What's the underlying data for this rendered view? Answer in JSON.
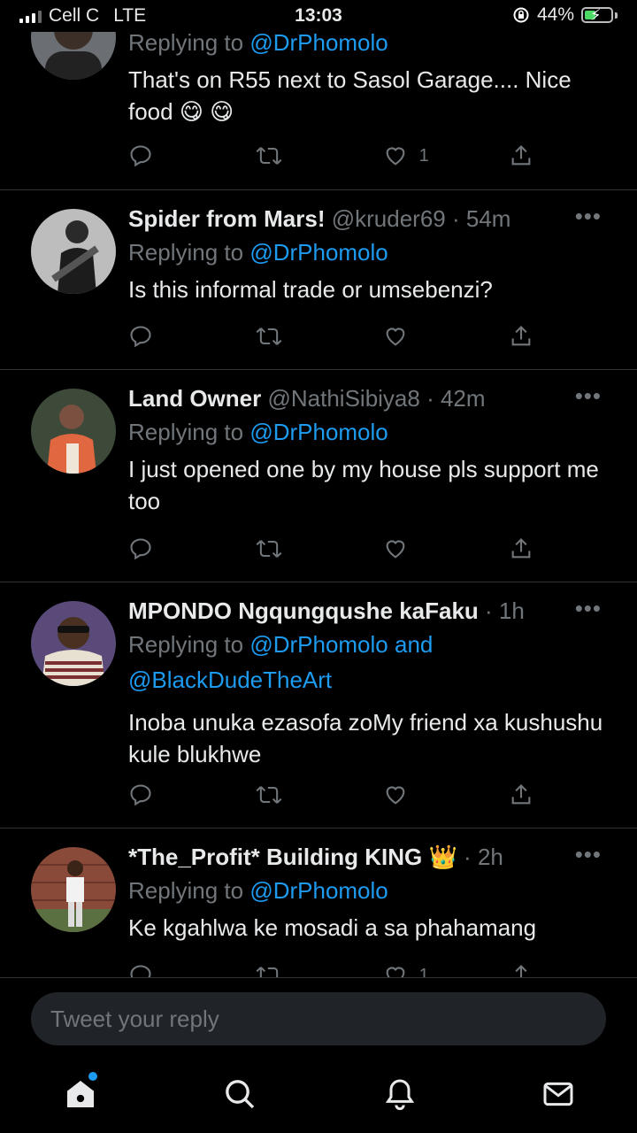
{
  "status_bar": {
    "carrier": "Cell C",
    "network": "LTE",
    "time": "13:03",
    "battery_percent_label": "44%",
    "battery_level": 0.44
  },
  "tweets": [
    {
      "name": "",
      "handle": "",
      "time": "",
      "replying_prefix": "Replying to",
      "mentions": [
        "@DrPhomolo"
      ],
      "text": "That's on R55 next to Sasol Garage.... Nice food 😋 😋",
      "likes": "1",
      "avatar_icon": "avatar-person-cap"
    },
    {
      "name": "Spider from Mars!",
      "handle": "@kruder69",
      "time": "54m",
      "replying_prefix": "Replying to",
      "mentions": [
        "@DrPhomolo"
      ],
      "text": "Is this informal trade or umsebenzi?",
      "likes": "",
      "avatar_icon": "avatar-guitarist"
    },
    {
      "name": "Land Owner",
      "handle": "@NathiSibiya8",
      "time": "42m",
      "replying_prefix": "Replying to",
      "mentions": [
        "@DrPhomolo"
      ],
      "text": "I just opened one by my house pls support me too",
      "likes": "",
      "avatar_icon": "avatar-man-orange-shirt"
    },
    {
      "name": "MPONDO Ngqungqushe kaFaku",
      "handle": "",
      "time": "1h",
      "replying_prefix": "Replying to",
      "mentions": [
        "@DrPhomolo",
        "@BlackDudeTheArt"
      ],
      "mention_joiner": "and",
      "text": "Inoba unuka ezasofa zoMy friend xa kushushu kule blukhwe",
      "likes": "",
      "avatar_icon": "avatar-sunglasses"
    },
    {
      "name": "*The_Profit* Building KING 👑",
      "handle": "",
      "time": "2h",
      "replying_prefix": "Replying to",
      "mentions": [
        "@DrPhomolo"
      ],
      "text": "Ke kgahlwa ke mosadi a sa phahamang",
      "likes": "1",
      "avatar_icon": "avatar-man-brick-wall"
    }
  ],
  "reply_box": {
    "placeholder": "Tweet your reply"
  },
  "tab_bar": {
    "items": [
      "home-icon",
      "search-icon",
      "notifications-icon",
      "messages-icon"
    ],
    "active": "home-icon",
    "accent": "#1d9bf0"
  },
  "colors": {
    "background": "#000000",
    "text": "#e7e9ea",
    "muted": "#71767b",
    "link": "#1d9bf0",
    "divider": "#2f3336"
  }
}
